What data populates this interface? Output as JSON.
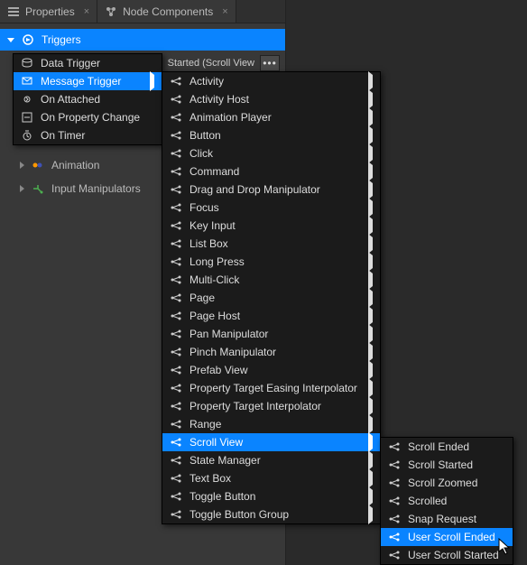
{
  "tabs": {
    "properties": "Properties",
    "node_components": "Node Components"
  },
  "sections": {
    "triggers": "Triggers",
    "animation": "Animation",
    "input_manipulators": "Input Manipulators"
  },
  "trigger_row": {
    "started_label": "Started (Scroll View",
    "dots": "•••"
  },
  "ctx1": {
    "items": [
      "Data Trigger",
      "Message Trigger",
      "On Attached",
      "On Property Change",
      "On Timer"
    ]
  },
  "ctx2": {
    "items": [
      "Activity",
      "Activity Host",
      "Animation Player",
      "Button",
      "Click",
      "Command",
      "Drag and Drop Manipulator",
      "Focus",
      "Key Input",
      "List Box",
      "Long Press",
      "Multi-Click",
      "Page",
      "Page Host",
      "Pan Manipulator",
      "Pinch Manipulator",
      "Prefab View",
      "Property Target Easing Interpolator",
      "Property Target Interpolator",
      "Range",
      "Scroll View",
      "State Manager",
      "Text Box",
      "Toggle Button",
      "Toggle Button Group"
    ]
  },
  "ctx3": {
    "items": [
      "Scroll Ended",
      "Scroll Started",
      "Scroll Zoomed",
      "Scrolled",
      "Snap Request",
      "User Scroll Ended",
      "User Scroll Started"
    ]
  }
}
